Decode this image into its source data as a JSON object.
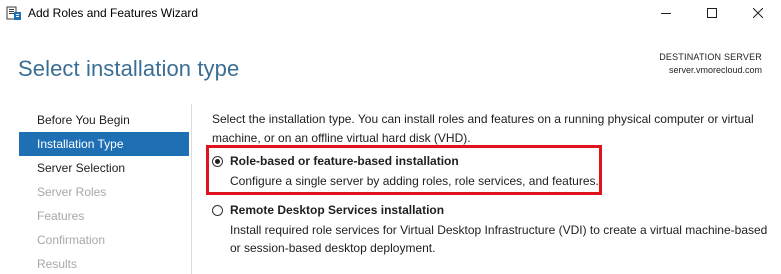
{
  "window": {
    "title": "Add Roles and Features Wizard",
    "icons": {
      "app": "server-manager-icon",
      "minimize": "minimize-icon",
      "maximize": "maximize-icon",
      "close": "close-icon"
    }
  },
  "header": {
    "page_title": "Select installation type",
    "destination_label": "DESTINATION SERVER",
    "destination_value": "server.vmorecloud.com"
  },
  "sidebar": {
    "items": [
      {
        "label": "Before You Begin",
        "state": "normal"
      },
      {
        "label": "Installation Type",
        "state": "active"
      },
      {
        "label": "Server Selection",
        "state": "normal"
      },
      {
        "label": "Server Roles",
        "state": "disabled"
      },
      {
        "label": "Features",
        "state": "disabled"
      },
      {
        "label": "Confirmation",
        "state": "disabled"
      },
      {
        "label": "Results",
        "state": "disabled"
      }
    ]
  },
  "main": {
    "intro": "Select the installation type. You can install roles and features on a running physical computer or virtual machine, or on an offline virtual hard disk (VHD).",
    "options": [
      {
        "title": "Role-based or feature-based installation",
        "description": "Configure a single server by adding roles, role services, and features.",
        "selected": true
      },
      {
        "title": "Remote Desktop Services installation",
        "description": "Install required role services for Virtual Desktop Infrastructure (VDI) to create a virtual machine-based or session-based desktop deployment.",
        "selected": false
      }
    ]
  },
  "colors": {
    "accent": "#1f6fb4",
    "title": "#3b6e94",
    "highlight": "#e0121c",
    "disabled": "#a8a8a8"
  }
}
